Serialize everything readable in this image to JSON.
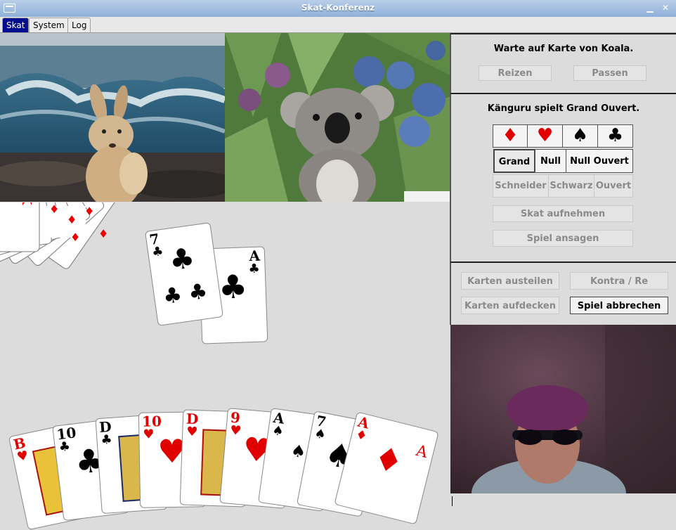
{
  "window": {
    "title": "Skat-Konferenz"
  },
  "tabs": [
    {
      "label": "Skat"
    },
    {
      "label": "System"
    },
    {
      "label": "Log"
    }
  ],
  "bidding": {
    "message": "Warte auf Karte von Koala.",
    "reizen_label": "Reizen",
    "passen_label": "Passen"
  },
  "game": {
    "message": "Känguru spielt Grand Ouvert.",
    "suits": [
      "♦",
      "♥",
      "♠",
      "♣"
    ],
    "types": [
      "Grand",
      "Null",
      "Null Ouvert"
    ],
    "options": [
      "Schneider",
      "Schwarz",
      "Ouvert"
    ],
    "skat_label": "Skat aufnehmen",
    "announce_label": "Spiel ansagen"
  },
  "controls": {
    "deal_label": "Karten austeilen",
    "kontra_label": "Kontra / Re",
    "reveal_label": "Karten aufdecken",
    "abort_label": "Spiel abbrechen"
  },
  "trick": [
    {
      "rank": "7",
      "suit": "♣"
    },
    {
      "rank": "A",
      "suit": "♣"
    }
  ],
  "hand": [
    {
      "rank": "B",
      "suit": "♥"
    },
    {
      "rank": "10",
      "suit": "♣"
    },
    {
      "rank": "D",
      "suit": "♣"
    },
    {
      "rank": "10",
      "suit": "♥"
    },
    {
      "rank": "D",
      "suit": "♥"
    },
    {
      "rank": "9",
      "suit": "♥"
    },
    {
      "rank": "A",
      "suit": "♠"
    },
    {
      "rank": "7",
      "suit": "♠"
    },
    {
      "rank": "A",
      "suit": "♦"
    }
  ],
  "colors": {
    "tab_active": "#000e8f",
    "red_suit": "#e00000"
  }
}
